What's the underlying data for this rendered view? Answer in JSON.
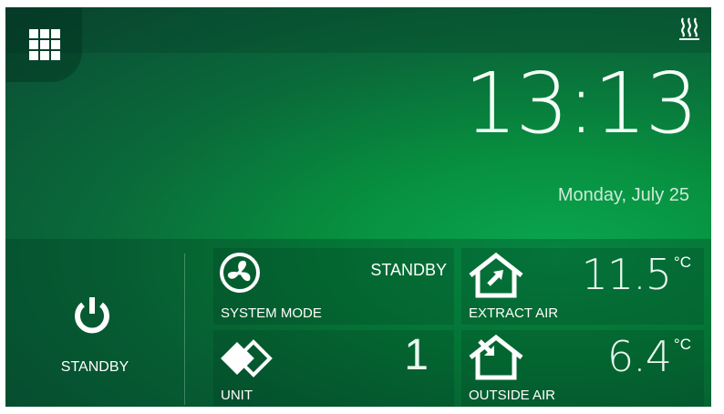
{
  "header": {
    "menu_icon": "grid-menu-icon",
    "heating_icon": "heating-icon"
  },
  "clock": {
    "time": "13:13",
    "date": "Monday, July 25"
  },
  "power": {
    "icon": "power-icon",
    "label": "STANDBY"
  },
  "tiles": {
    "system_mode": {
      "label": "SYSTEM MODE",
      "value": "STANDBY",
      "icon": "fan-icon"
    },
    "unit": {
      "label": "UNIT",
      "value": "1",
      "icon": "unit-diamond-icon"
    },
    "extract_air": {
      "label": "EXTRACT AIR",
      "value": "11.5",
      "unit": "°C",
      "icon": "house-extract-icon"
    },
    "outside_air": {
      "label": "OUTSIDE AIR",
      "value": "6.4",
      "unit": "°C",
      "icon": "house-outside-icon"
    }
  },
  "navigation": {
    "next_icon": "next-page-arrow-icon"
  },
  "colors": {
    "accent_green": "#07903f",
    "dark_green": "#0b4a34",
    "text": "#ffffff"
  }
}
